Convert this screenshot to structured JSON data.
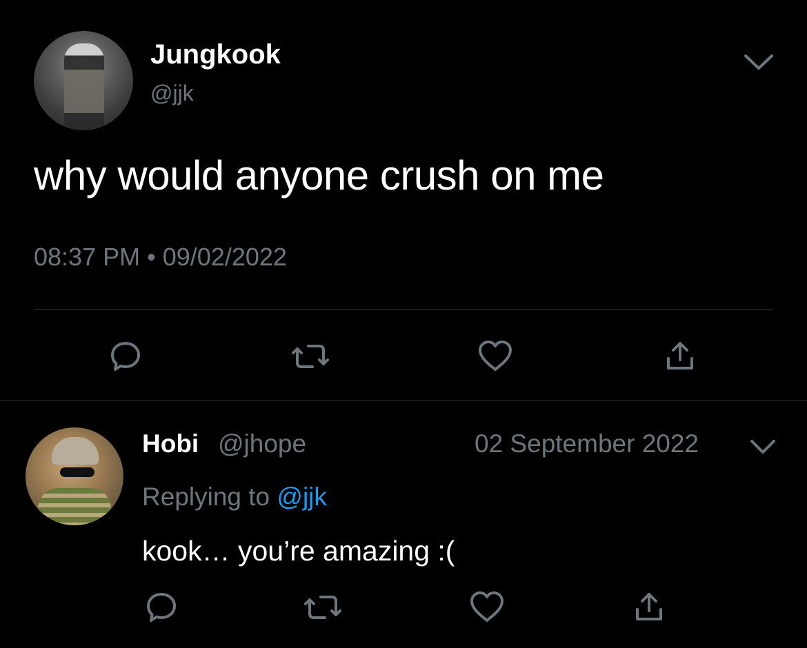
{
  "colors": {
    "background": "#000000",
    "primary_text": "#ffffff",
    "secondary_text": "#6e767d",
    "link": "#1d9bf0",
    "divider": "#2f3336",
    "icon": "#6e767d"
  },
  "main_tweet": {
    "display_name": "Jungkook",
    "handle": "@jjk",
    "text": "why would anyone crush on me",
    "time": "08:37 PM",
    "separator": "•",
    "date": "09/02/2022",
    "actions": [
      "reply-icon",
      "retweet-icon",
      "like-icon",
      "share-icon"
    ],
    "menu_icon": "chevron-down-icon"
  },
  "reply": {
    "display_name": "Hobi",
    "handle": "@jhope",
    "date": "02 September 2022",
    "replying_prefix": "Replying to",
    "replying_handle": "@jjk",
    "text": "kook… you’re amazing :(",
    "actions": [
      "reply-icon",
      "retweet-icon",
      "like-icon",
      "share-icon"
    ],
    "menu_icon": "chevron-down-icon"
  }
}
